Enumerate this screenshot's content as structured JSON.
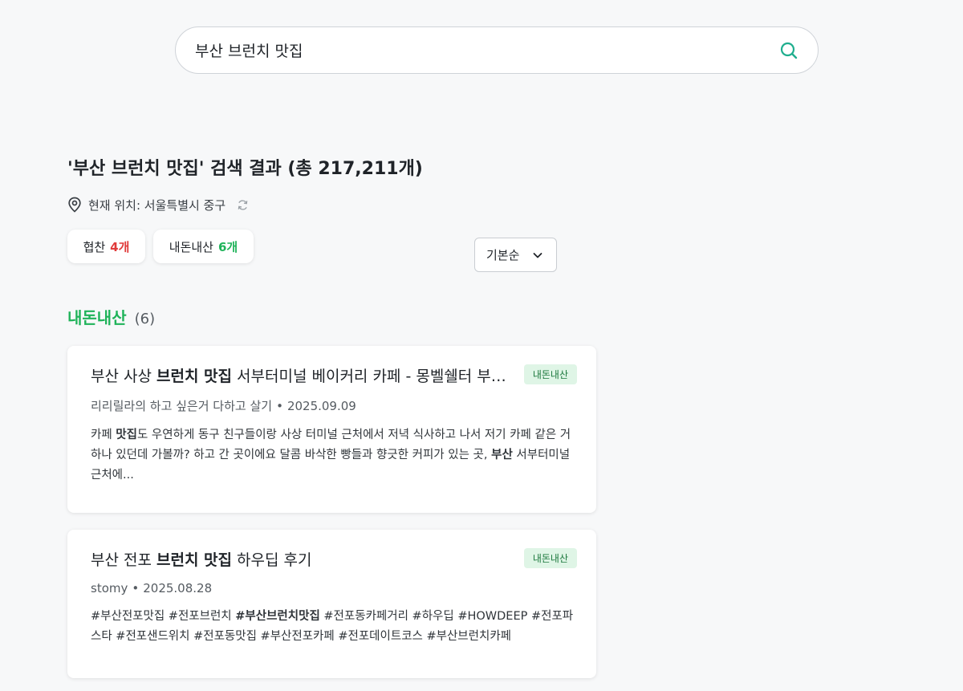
{
  "search": {
    "query": "부산 브런치 맛집"
  },
  "results_header": {
    "title": "'부산 브런치 맛집' 검색 결과 (총 217,211개)",
    "location": "현재 위치: 서울특별시 중구"
  },
  "filters": [
    {
      "label": "협찬",
      "count": "4개"
    },
    {
      "label": "내돈내산",
      "count": "6개"
    }
  ],
  "sort": {
    "selected": "기본순"
  },
  "section": {
    "title": "내돈내산",
    "count": "(6)"
  },
  "cards": [
    {
      "title_pre": "부산 사상 ",
      "title_bold": "브런치 맛집",
      "title_post": " 서부터미널 베이커리 카페 - 몽벨쉘터 부산 사상점",
      "badge": "내돈내산",
      "author": "리리릴라의 하고 싶은거 다하고 살기",
      "date": "2025.09.09",
      "body_1": "카페 ",
      "body_1b": "맛집",
      "body_2": "도 우연하게 동구 친구들이랑 사상 터미널 근처에서 저녁 식사하고 나서 저기 카페 같은 거 하나 있던데 가볼까? 하고 간 곳이에요 달콤 바삭한 빵들과 향긋한 커피가 있는 곳, ",
      "body_2b": "부산",
      "body_3": " 서부터미널 근처에..."
    },
    {
      "title_pre": "부산 전포 ",
      "title_bold": "브런치 맛집",
      "title_post": " 하우딥 후기",
      "badge": "내돈내산",
      "author": "stomy",
      "date": "2025.08.28",
      "body_1": "#부산전포맛집 #전포브런치 ",
      "body_1b": "#부산브런치맛집",
      "body_2": " #전포동카페거리 #하우딥 #HOWDEEP #전포파스타 #전포샌드위치 #전포동맛집 #부산전포카페 #전포데이트코스 #부산브런치카페"
    }
  ],
  "colors": {
    "accent_green": "#20b35a",
    "sponsored_red": "#e03a3a",
    "search_icon": "#1fae8e",
    "badge_bg": "#dff5e6"
  },
  "icons": {
    "search": "search-icon",
    "location": "location-pin-icon",
    "refresh": "refresh-icon",
    "chevron": "chevron-down-icon"
  }
}
